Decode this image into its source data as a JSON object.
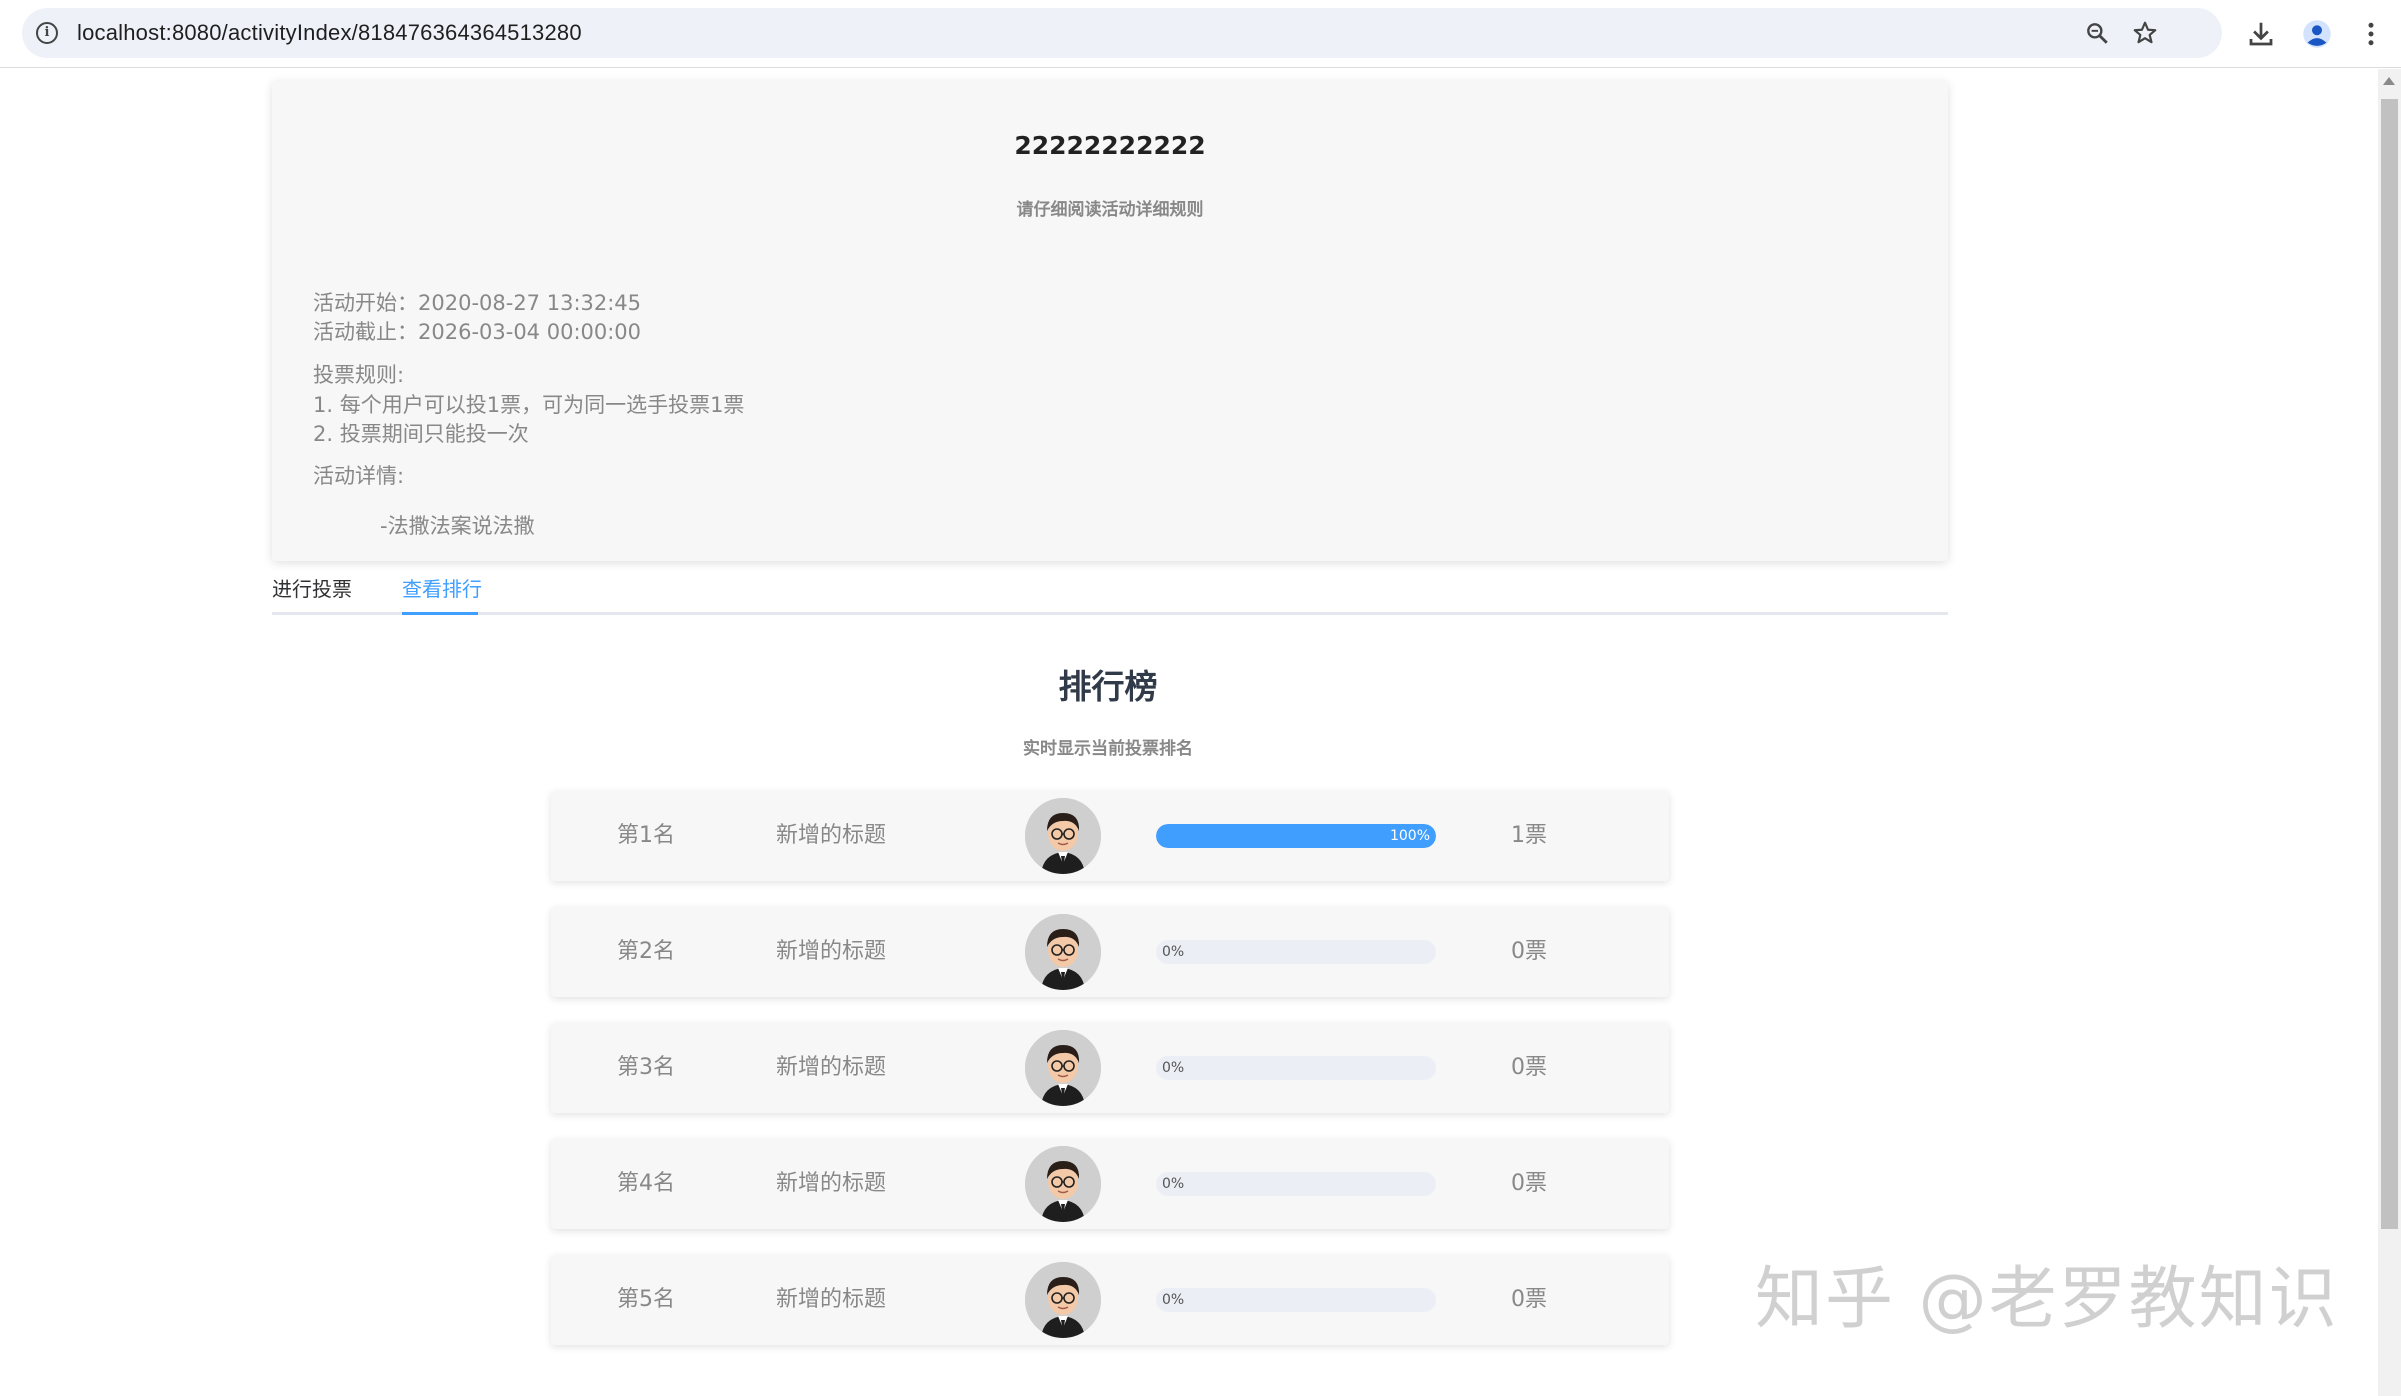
{
  "browser": {
    "url": "localhost:8080/activityIndex/818476364364513280"
  },
  "activity": {
    "title": "22222222222",
    "subtitle": "请仔细阅读活动详细规则",
    "start": "活动开始：2020-08-27 13:32:45",
    "end": "活动截止：2026-03-04 00:00:00",
    "rules_label": "投票规则:",
    "rule_1": "1. 每个用户可以投1票，可为同一选手投票1票",
    "rule_2": "2. 投票期间只能投一次",
    "details_label": "活动详情:",
    "details_text": "-法撒法案说法撒"
  },
  "tabs": {
    "vote": "进行投票",
    "rank": "查看排行",
    "active": "rank"
  },
  "ranking": {
    "title": "排行榜",
    "subtitle": "实时显示当前投票排名",
    "rows": [
      {
        "position": "第1名",
        "name": "新增的标题",
        "percent": 100,
        "percent_label": "100%",
        "votes": "1票"
      },
      {
        "position": "第2名",
        "name": "新增的标题",
        "percent": 0,
        "percent_label": "0%",
        "votes": "0票"
      },
      {
        "position": "第3名",
        "name": "新增的标题",
        "percent": 0,
        "percent_label": "0%",
        "votes": "0票"
      },
      {
        "position": "第4名",
        "name": "新增的标题",
        "percent": 0,
        "percent_label": "0%",
        "votes": "0票"
      },
      {
        "position": "第5名",
        "name": "新增的标题",
        "percent": 0,
        "percent_label": "0%",
        "votes": "0票"
      }
    ]
  },
  "colors": {
    "accent": "#409eff",
    "track": "#ebeef5",
    "muted_text": "#888888"
  },
  "watermark": "知乎 @老罗教知识"
}
